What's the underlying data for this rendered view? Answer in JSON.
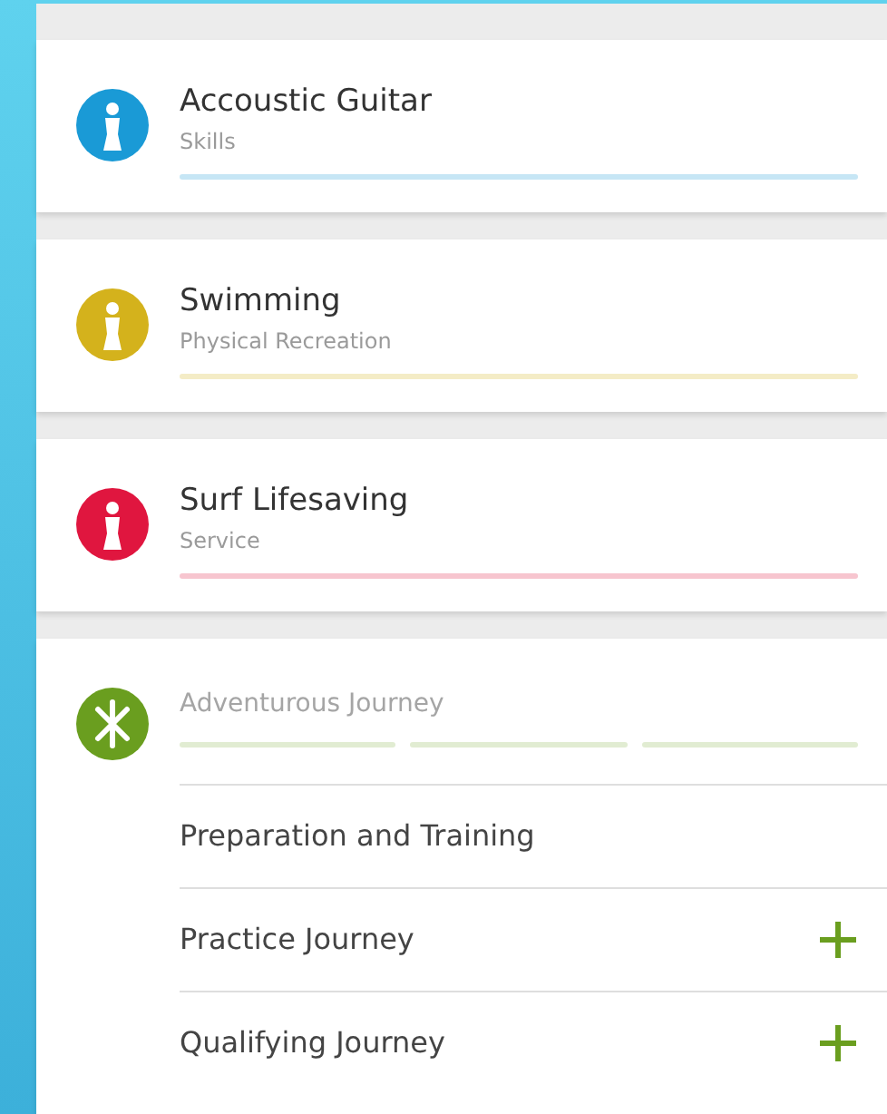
{
  "activities": [
    {
      "kind": "award",
      "title": "Accoustic Guitar",
      "subtitle": "Skills",
      "color": "#1a9ad6"
    },
    {
      "kind": "award",
      "title": "Swimming",
      "subtitle": "Physical Recreation",
      "color": "#d4b21c"
    },
    {
      "kind": "award",
      "title": "Surf Lifesaving",
      "subtitle": "Service",
      "color": "#e0163f"
    },
    {
      "kind": "journey",
      "title": "Adventurous Journey",
      "color": "#6a9e1f",
      "steps": [
        {
          "label": "Preparation and Training",
          "addable": false
        },
        {
          "label": "Practice Journey",
          "addable": true
        },
        {
          "label": "Qualifying Journey",
          "addable": true
        }
      ]
    }
  ]
}
